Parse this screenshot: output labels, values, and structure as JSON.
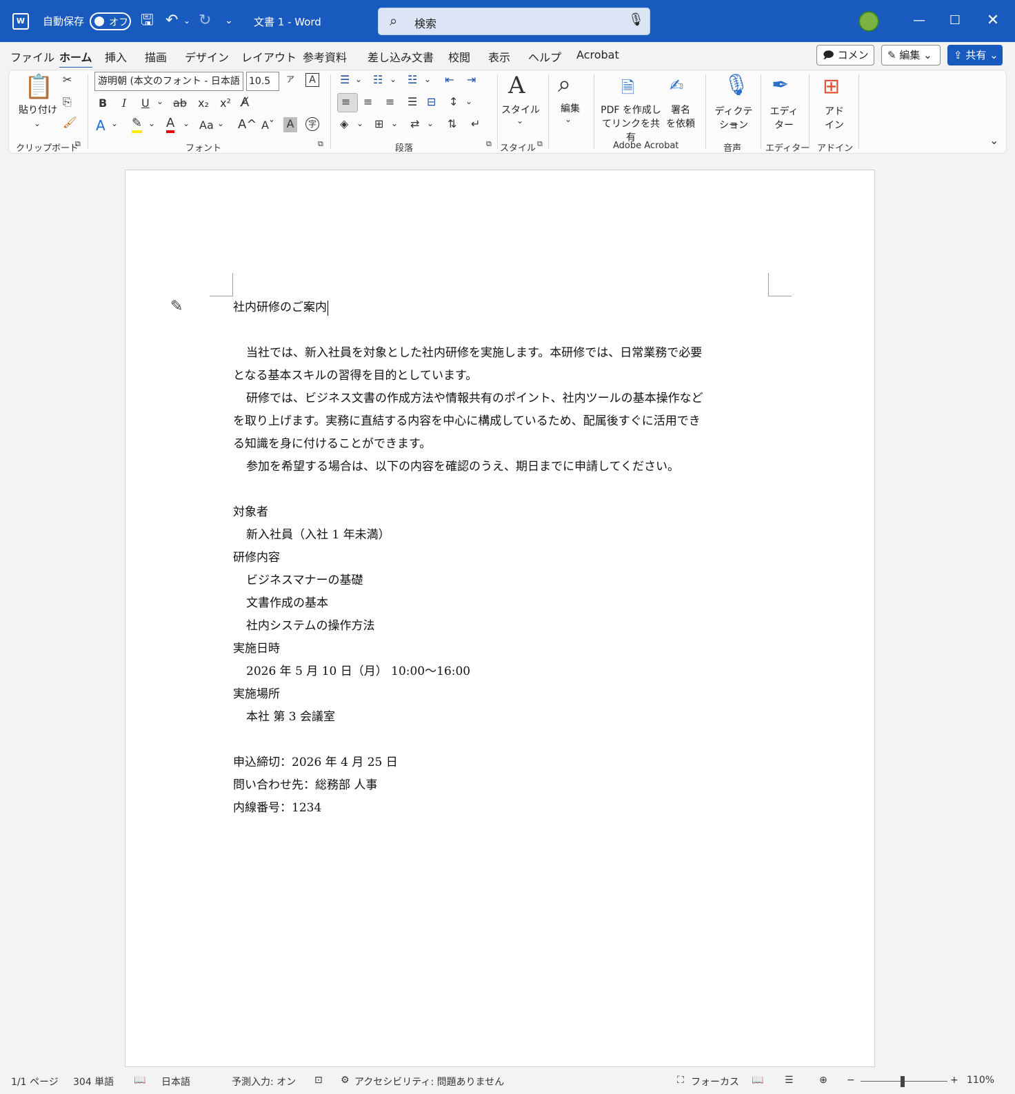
{
  "titlebar": {
    "autosave_label": "自動保存",
    "autosave_state": "オフ",
    "doc_title": "文書 1  -  Word",
    "search_placeholder": "検索"
  },
  "menu": {
    "tabs": [
      "ファイル",
      "ホーム",
      "挿入",
      "描画",
      "デザイン",
      "レイアウト",
      "参考資料",
      "差し込み文書",
      "校閲",
      "表示",
      "ヘルプ",
      "Acrobat"
    ],
    "active_tab": "ホーム",
    "comment_label": "コメント",
    "edit_label": "編集",
    "share_label": "共有"
  },
  "ribbon": {
    "paste_label": "貼り付け",
    "font_name": "游明朝 (本文のフォント - 日本語",
    "font_size": "10.5",
    "style_label": "スタイル",
    "edit_label": "編集",
    "pdf_label_1": "PDF を作成し",
    "pdf_label_2": "てリンクを共有",
    "sign_label_1": "署名",
    "sign_label_2": "を依頼",
    "dictate_label_1": "ディクテー",
    "dictate_label_2": "ション",
    "editor_label_1": "エディ",
    "editor_label_2": "ター",
    "addin_label_1": "アド",
    "addin_label_2": "イン",
    "groups": {
      "clipboard": "クリップボード",
      "font": "フォント",
      "paragraph": "段落",
      "styles": "スタイル",
      "acrobat": "Adobe Acrobat",
      "voice": "音声",
      "editor": "エディター",
      "addins": "アドイン"
    }
  },
  "document": {
    "title": "社内研修のご案内",
    "p1_line1": "当社では、新入社員を対象とした社内研修を実施します。本研修では、日常業務で必要",
    "p1_line2": "となる基本スキルの習得を目的としています。",
    "p2_line1": "研修では、ビジネス文書の作成方法や情報共有のポイント、社内ツールの基本操作など",
    "p2_line2": "を取り上げます。実務に直結する内容を中心に構成しているため、配属後すぐに活用でき",
    "p2_line3": "る知識を身に付けることができます。",
    "p3_line1": "参加を希望する場合は、以下の内容を確認のうえ、期日までに申請してください。",
    "target_heading": "対象者",
    "target_value": "新入社員（入社 1 年未満）",
    "content_heading": "研修内容",
    "content_items": [
      "ビジネスマナーの基礎",
      "文書作成の基本",
      "社内システムの操作方法"
    ],
    "date_heading": "実施日時",
    "date_value": "2026 年 5 月 10 日（月）  10:00～16:00",
    "place_heading": "実施場所",
    "place_value": "本社  第 3 会議室",
    "deadline": "申込締切：2026 年 4 月 25 日",
    "contact": "問い合わせ先：総務部  人事",
    "extension": "内線番号：1234"
  },
  "statusbar": {
    "page": "1/1 ページ",
    "words": "304 単語",
    "language": "日本語",
    "predict": "予測入力: オン",
    "accessibility": "アクセシビリティ: 問題ありません",
    "focus": "フォーカス",
    "zoom": "110%"
  }
}
